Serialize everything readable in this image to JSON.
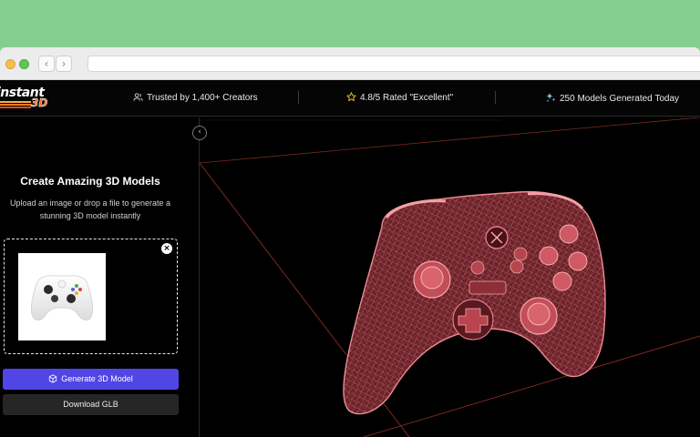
{
  "browser": {
    "back_icon": "‹",
    "forward_icon": "›"
  },
  "logo": {
    "word1": "instant",
    "word2": "3D"
  },
  "stats": {
    "creators": "Trusted by 1,400+ Creators",
    "rating": "4.8/5 Rated \"Excellent\"",
    "generated": "250 Models Generated Today"
  },
  "panel": {
    "collapse_icon": "‹",
    "title": "Create Amazing 3D Models",
    "subtitle": "Upload an image or drop a file to generate a stunning 3D model instantly",
    "remove_icon": "×",
    "generate_label": "Generate 3D Model",
    "download_label": "Download GLB"
  },
  "colors": {
    "accent": "#5046e5",
    "wireframe": "#e8727a",
    "grid_line": "#a0332b"
  }
}
